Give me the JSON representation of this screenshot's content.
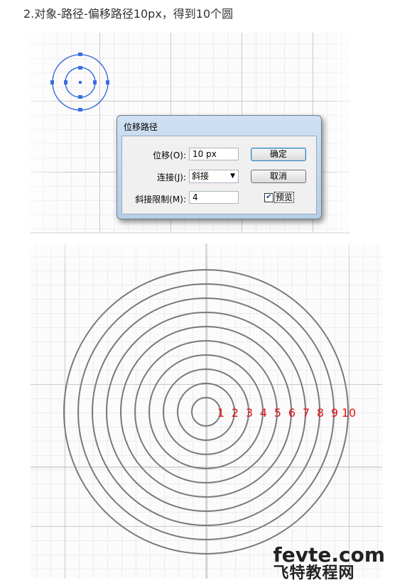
{
  "heading": "2.对象-路径-偏移路径10px，得到10个圆",
  "dialog": {
    "title": "位移路径",
    "offset_label": "位移(O):",
    "offset_value": "10 px",
    "joins_label": "连接(J):",
    "joins_value": "斜接",
    "miter_label": "斜接限制(M):",
    "miter_value": "4",
    "ok_label": "确定",
    "cancel_label": "取消",
    "preview_label": "预览",
    "preview_checked": true
  },
  "ring_labels": [
    "1",
    "2",
    "3",
    "4",
    "5",
    "6",
    "7",
    "8",
    "9",
    "10"
  ],
  "colors": {
    "label_red": "#e8141b",
    "ring_gray": "#7a7a7a",
    "selection_blue": "#3a6fe0"
  },
  "watermark": {
    "line1": "fevte.com",
    "line2": "飞特教程网"
  }
}
